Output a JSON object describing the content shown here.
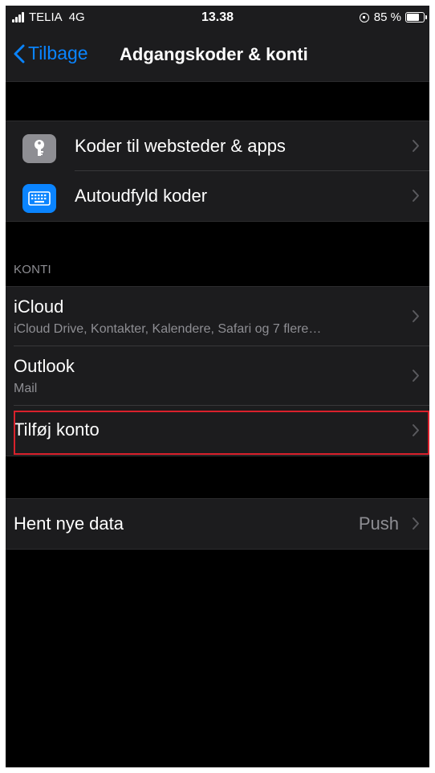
{
  "status_bar": {
    "carrier": "TELIA",
    "network": "4G",
    "time": "13.38",
    "battery": "85 %",
    "battery_level": 0.85
  },
  "nav": {
    "back_label": "Tilbage",
    "title": "Adgangskoder & konti"
  },
  "passwords_group": {
    "items": [
      {
        "label": "Koder til websteder & apps",
        "icon": "key-icon"
      },
      {
        "label": "Autoudfyld koder",
        "icon": "keyboard-icon"
      }
    ]
  },
  "accounts": {
    "header": "KONTI",
    "items": [
      {
        "title": "iCloud",
        "subtitle": "iCloud Drive, Kontakter, Kalendere, Safari og 7 flere…"
      },
      {
        "title": "Outlook",
        "subtitle": "Mail"
      },
      {
        "title": "Tilføj konto"
      }
    ]
  },
  "fetch": {
    "label": "Hent nye data",
    "value": "Push"
  },
  "colors": {
    "accent": "#0a84ff",
    "highlight": "#d9212c",
    "background": "#000000",
    "cell": "#1c1c1e"
  }
}
